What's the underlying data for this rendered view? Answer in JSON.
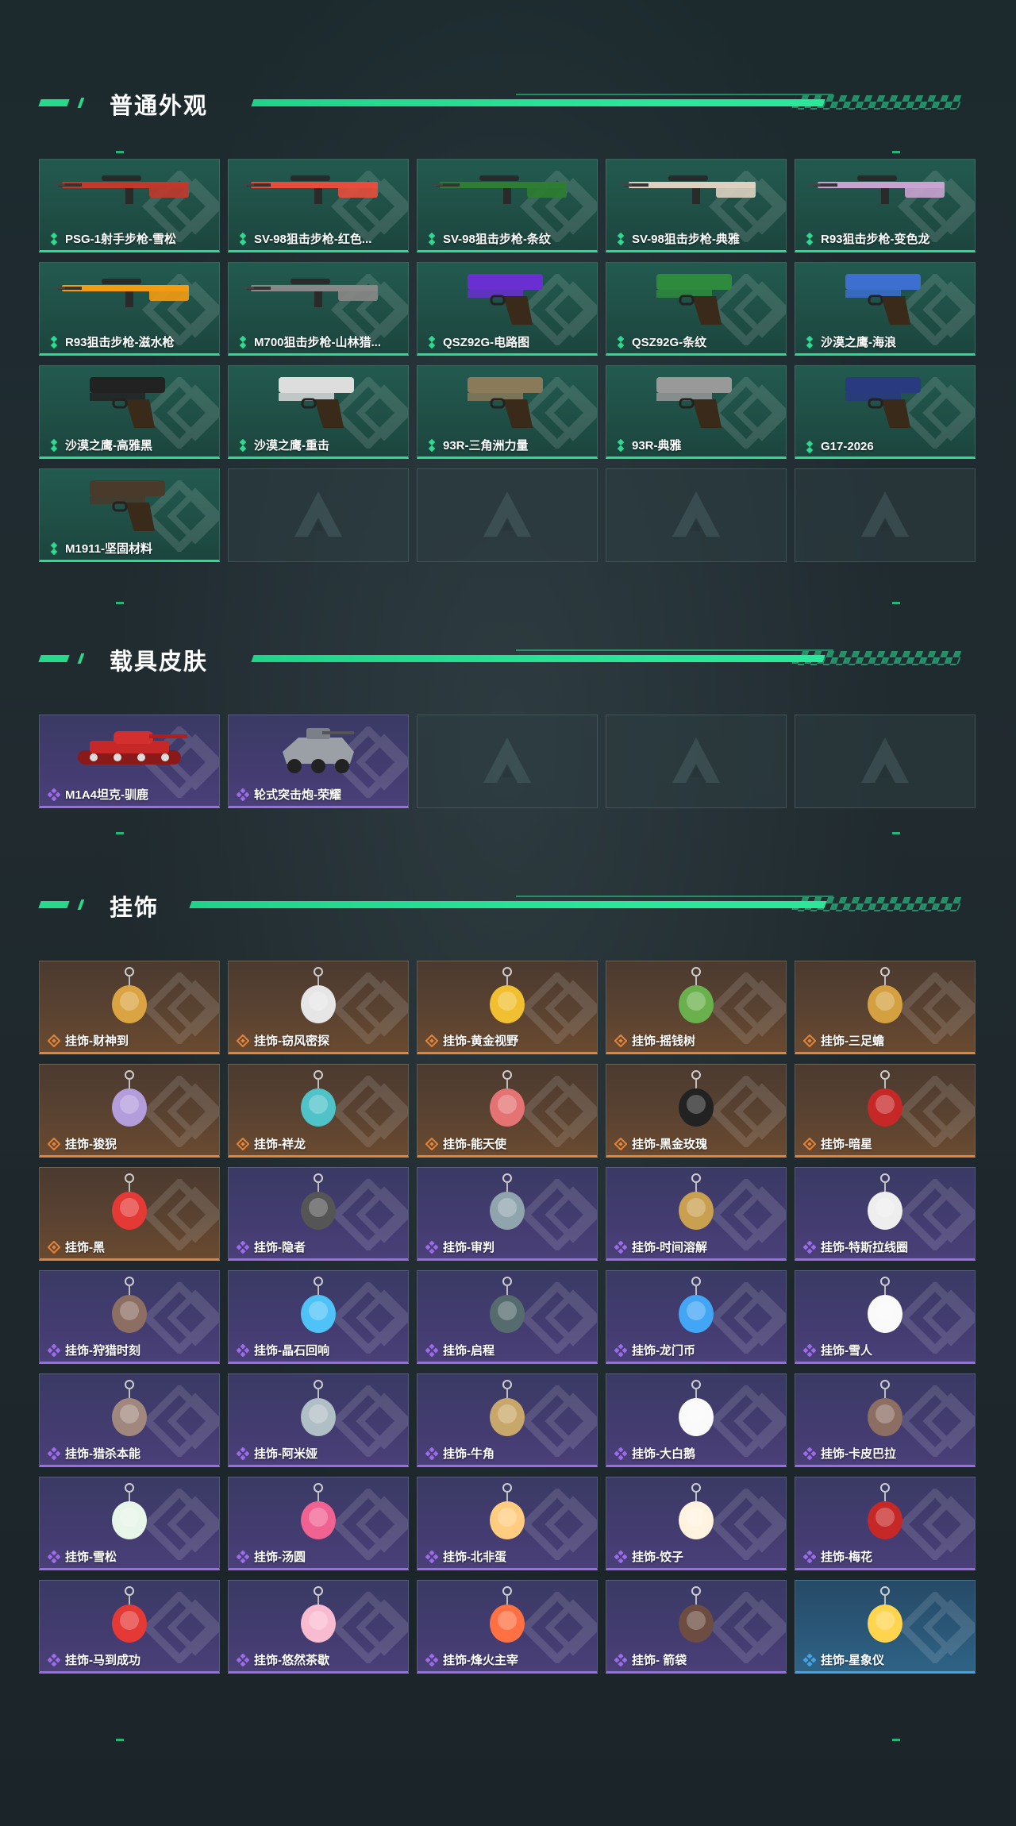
{
  "sections": [
    {
      "title": "普通外观",
      "items": [
        {
          "label": "PSG-1射手步枪-雪松",
          "rarity": "green",
          "icon": "rifle-icon"
        },
        {
          "label": "SV-98狙击步枪-红色...",
          "rarity": "green",
          "icon": "rifle-icon"
        },
        {
          "label": "SV-98狙击步枪-条纹",
          "rarity": "green",
          "icon": "rifle-icon"
        },
        {
          "label": "SV-98狙击步枪-典雅",
          "rarity": "green",
          "icon": "rifle-icon"
        },
        {
          "label": "R93狙击步枪-变色龙",
          "rarity": "green",
          "icon": "rifle-icon"
        },
        {
          "label": "R93狙击步枪-滋水枪",
          "rarity": "green",
          "icon": "rifle-icon"
        },
        {
          "label": "M700狙击步枪-山林猎...",
          "rarity": "green",
          "icon": "rifle-icon"
        },
        {
          "label": "QSZ92G-电路图",
          "rarity": "green",
          "icon": "pistol-icon"
        },
        {
          "label": "QSZ92G-条纹",
          "rarity": "green",
          "icon": "pistol-icon"
        },
        {
          "label": "沙漠之鹰-海浪",
          "rarity": "green",
          "icon": "pistol-icon"
        },
        {
          "label": "沙漠之鹰-高雅黑",
          "rarity": "green",
          "icon": "pistol-icon"
        },
        {
          "label": "沙漠之鹰-重击",
          "rarity": "green",
          "icon": "pistol-icon"
        },
        {
          "label": "93R-三角洲力量",
          "rarity": "green",
          "icon": "pistol-icon"
        },
        {
          "label": "93R-典雅",
          "rarity": "green",
          "icon": "pistol-icon"
        },
        {
          "label": "G17-2026",
          "rarity": "green",
          "icon": "pistol-icon"
        },
        {
          "label": "M1911-坚固材料",
          "rarity": "green",
          "icon": "pistol-icon"
        }
      ],
      "empty_slots": 4
    },
    {
      "title": "载具皮肤",
      "items": [
        {
          "label": "M1A4坦克-驯鹿",
          "rarity": "purple",
          "icon": "tank-icon"
        },
        {
          "label": "轮式突击炮-荣耀",
          "rarity": "purple",
          "icon": "armored-vehicle-icon"
        }
      ],
      "empty_slots": 3
    },
    {
      "title": "挂饰",
      "items": [
        {
          "label": "挂饰-财神到",
          "rarity": "orange",
          "icon": "charm-icon"
        },
        {
          "label": "挂饰-窃风密探",
          "rarity": "orange",
          "icon": "charm-icon"
        },
        {
          "label": "挂饰-黄金视野",
          "rarity": "orange",
          "icon": "charm-icon"
        },
        {
          "label": "挂饰-摇钱树",
          "rarity": "orange",
          "icon": "charm-icon"
        },
        {
          "label": "挂饰-三足蟾",
          "rarity": "orange",
          "icon": "charm-icon"
        },
        {
          "label": "挂饰-狻猊",
          "rarity": "orange",
          "icon": "charm-icon"
        },
        {
          "label": "挂饰-祥龙",
          "rarity": "orange",
          "icon": "charm-icon"
        },
        {
          "label": "挂饰-能天使",
          "rarity": "orange",
          "icon": "charm-icon"
        },
        {
          "label": "挂饰-黑金玫瑰",
          "rarity": "orange",
          "icon": "charm-icon"
        },
        {
          "label": "挂饰-暗星",
          "rarity": "orange",
          "icon": "charm-icon"
        },
        {
          "label": "挂饰-黑",
          "rarity": "orange",
          "icon": "charm-icon"
        },
        {
          "label": "挂饰-隐者",
          "rarity": "purple",
          "icon": "charm-icon"
        },
        {
          "label": "挂饰-审判",
          "rarity": "purple",
          "icon": "charm-icon"
        },
        {
          "label": "挂饰-时间溶解",
          "rarity": "purple",
          "icon": "charm-icon"
        },
        {
          "label": "挂饰-特斯拉线圈",
          "rarity": "purple",
          "icon": "charm-icon"
        },
        {
          "label": "挂饰-狩猎时刻",
          "rarity": "purple",
          "icon": "charm-icon"
        },
        {
          "label": "挂饰-晶石回响",
          "rarity": "purple",
          "icon": "charm-icon"
        },
        {
          "label": "挂饰-启程",
          "rarity": "purple",
          "icon": "charm-icon"
        },
        {
          "label": "挂饰-龙门币",
          "rarity": "purple",
          "icon": "charm-icon"
        },
        {
          "label": "挂饰-雪人",
          "rarity": "purple",
          "icon": "charm-icon"
        },
        {
          "label": "挂饰-猎杀本能",
          "rarity": "purple",
          "icon": "charm-icon"
        },
        {
          "label": "挂饰-阿米娅",
          "rarity": "purple",
          "icon": "charm-icon"
        },
        {
          "label": "挂饰-牛角",
          "rarity": "purple",
          "icon": "charm-icon"
        },
        {
          "label": "挂饰-大白鹅",
          "rarity": "purple",
          "icon": "charm-icon"
        },
        {
          "label": "挂饰-卡皮巴拉",
          "rarity": "purple",
          "icon": "charm-icon"
        },
        {
          "label": "挂饰-雪松",
          "rarity": "purple",
          "icon": "charm-icon"
        },
        {
          "label": "挂饰-汤圆",
          "rarity": "purple",
          "icon": "charm-icon"
        },
        {
          "label": "挂饰-北非蛋",
          "rarity": "purple",
          "icon": "charm-icon"
        },
        {
          "label": "挂饰-饺子",
          "rarity": "purple",
          "icon": "charm-icon"
        },
        {
          "label": "挂饰-梅花",
          "rarity": "purple",
          "icon": "charm-icon"
        },
        {
          "label": "挂饰-马到成功",
          "rarity": "purple",
          "icon": "charm-icon"
        },
        {
          "label": "挂饰-悠然茶歇",
          "rarity": "purple",
          "icon": "charm-icon"
        },
        {
          "label": "挂饰-烽火主宰",
          "rarity": "purple",
          "icon": "charm-icon"
        },
        {
          "label": "挂饰- 箭袋",
          "rarity": "purple",
          "icon": "charm-icon"
        },
        {
          "label": "挂饰-星象仪",
          "rarity": "blue",
          "icon": "charm-icon"
        }
      ],
      "empty_slots": 0
    }
  ],
  "colors": {
    "accent": "#27d98b",
    "green": "#2ddb8f",
    "purple": "#9b6be8",
    "orange": "#e2843a",
    "blue": "#46a4e6"
  }
}
